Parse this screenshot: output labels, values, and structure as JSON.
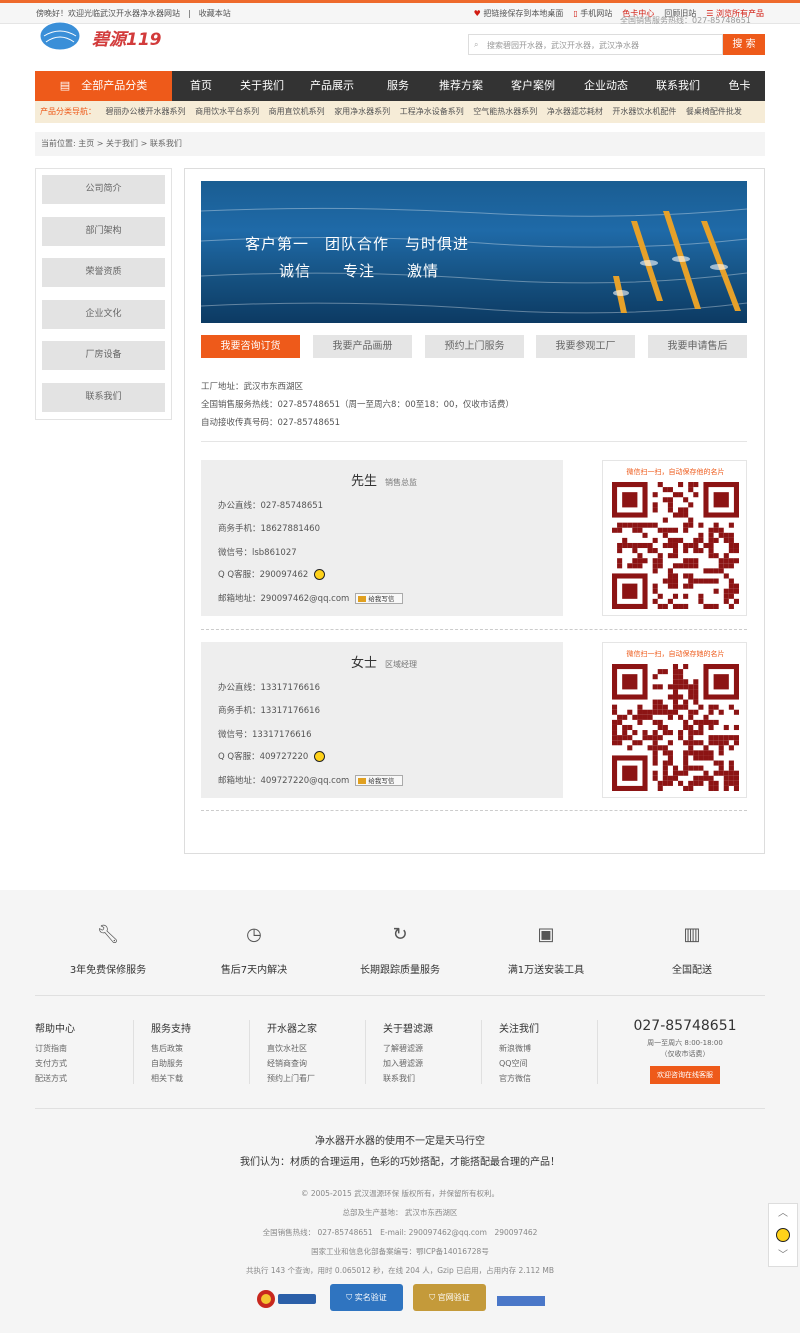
{
  "topbar": {
    "welcome": "傍晚好！欢迎光临武汉开水器净水器网站",
    "bookmark": "收藏本站",
    "save_desktop": "把链接保存到本地桌面",
    "mobile": "手机网站",
    "color_card": "色卡中心",
    "old_site": "回顾旧站",
    "browse_all": "浏览所有产品"
  },
  "header": {
    "logo_text": "碧源119",
    "hotline": "全国销售服务热线：027-85748651",
    "search_placeholder": "搜索碧园开水器，武汉开水器，武汉净水器",
    "search_button": "搜 索"
  },
  "nav": {
    "category_button": "全部产品分类",
    "items": [
      "首页",
      "关于我们",
      "产品展示",
      "服务",
      "推荐方案",
      "客户案例",
      "企业动态",
      "联系我们",
      "色卡"
    ]
  },
  "subnav": {
    "label": "产品分类导航：",
    "items": [
      "碧丽办公楼开水器系列",
      "商用饮水平台系列",
      "商用直饮机系列",
      "家用净水器系列",
      "工程净水设备系列",
      "空气能热水器系列",
      "净水器滤芯耗材",
      "开水器饮水机配件",
      "餐桌椅配件批发"
    ]
  },
  "breadcrumb": "当前位置: 主页 > 关于我们 > 联系我们",
  "sidebar": {
    "items": [
      "公司简介",
      "部门架构",
      "荣誉资质",
      "企业文化",
      "厂房设备",
      "联系我们"
    ]
  },
  "banner": {
    "line1": "客户第一　团队合作　与时俱进",
    "line2": "诚信　　专注　　激情"
  },
  "tabs": [
    "我要咨询订货",
    "我要产品画册",
    "预约上门服务",
    "我要参观工厂",
    "我要申请售后"
  ],
  "company": {
    "address": "工厂地址：武汉市东西湖区",
    "hotline": "全国销售服务热线：027-85748651（周一至周六8：00至18：00，仅收市话费）",
    "fax": "自动接收传真号码：027-85748651"
  },
  "contacts": [
    {
      "name": "先生",
      "role": "销售总监",
      "office": "办公直线：027-85748651",
      "mobile": "商务手机：18627881460",
      "wechat": "微信号：lsb861027",
      "qq": "Q Q客服：290097462",
      "email": "邮箱地址：290097462@qq.com",
      "mail_btn": "给我写信",
      "qr_caption": "微信扫一扫，自动保存他的名片"
    },
    {
      "name": "女士",
      "role": "区域经理",
      "office": "办公直线：13317176616",
      "mobile": "商务手机：13317176616",
      "wechat": "微信号：13317176616",
      "qq": "Q Q客服：409727220",
      "email": "邮箱地址：409727220@qq.com",
      "mail_btn": "给我写信",
      "qr_caption": "微信扫一扫，自动保存她的名片"
    }
  ],
  "features": [
    "3年免费保修服务",
    "售后7天内解决",
    "长期跟踪质量服务",
    "满1万送安装工具",
    "全国配送"
  ],
  "footer_cols": [
    {
      "title": "帮助中心",
      "items": [
        "订货指南",
        "支付方式",
        "配送方式"
      ]
    },
    {
      "title": "服务支持",
      "items": [
        "售后政策",
        "自助服务",
        "相关下载"
      ]
    },
    {
      "title": "开水器之家",
      "items": [
        "直饮水社区",
        "经销商查询",
        "预约上门看厂"
      ]
    },
    {
      "title": "关于碧滤源",
      "items": [
        "了解碧滤源",
        "加入碧滤源",
        "联系我们"
      ]
    },
    {
      "title": "关注我们",
      "items": [
        "新浪微博",
        "QQ空间",
        "官方微信"
      ]
    }
  ],
  "footer_phone": {
    "number": "027-85748651",
    "hours": "周一至周六 8:00-18:00",
    "note": "（仅收市话费）",
    "button": "欢迎咨询在线客服"
  },
  "slogan": {
    "line1": "净水器开水器的使用不一定是天马行空",
    "line2": "我们认为：材质的合理运用，色彩的巧妙搭配，才能搭配最合理的产品！"
  },
  "copyright": {
    "line1": "© 2005-2015 武汉温源环保 版权所有，并保留所有权利。",
    "line2": "总部及生产基地： 武汉市东西湖区",
    "line3": "全国销售热线： 027-85748651　E-mail: 290097462@qq.com　290097462",
    "line4": "国家工业和信息化部备案编号：鄂ICP备14016728号",
    "line5": "共执行 143 个查询，用时 0.065012 秒，在线 204 人，Gzip 已启用，占用内存 2.112 MB"
  },
  "badges": [
    "实名验证",
    "官网验证"
  ],
  "colors": {
    "accent": "#ee5a1a",
    "nav_bg": "#333333",
    "subnav_bg": "#f6ecd7",
    "qr": "#8c1414"
  }
}
